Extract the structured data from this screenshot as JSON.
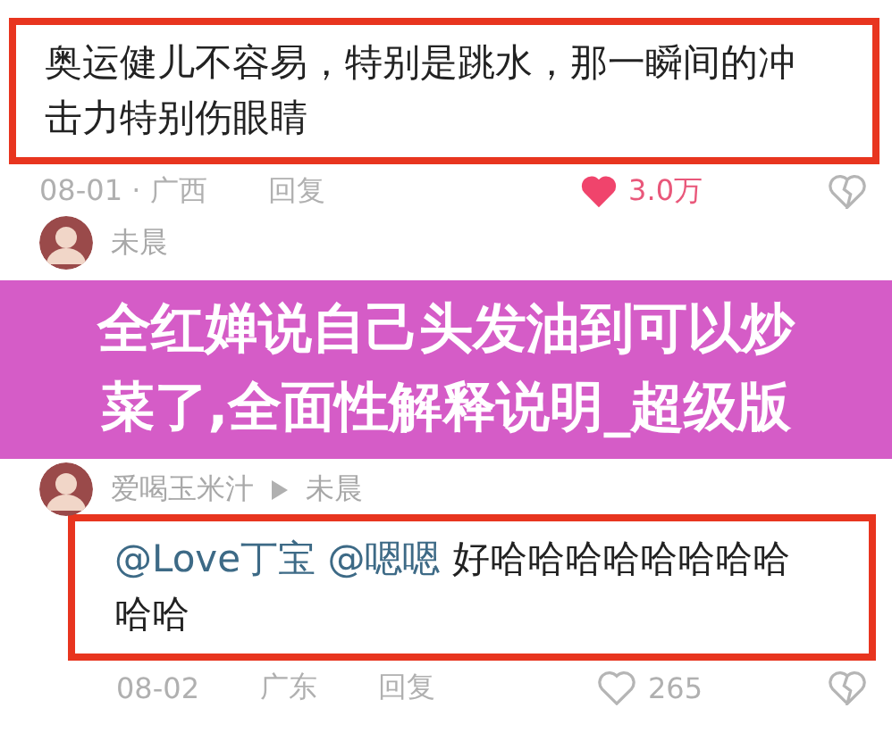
{
  "comments": [
    {
      "highlighted": true,
      "text": "奥运健儿不容易，特别是跳水，那一瞬间的冲击力特别伤眼睛",
      "time": "08-01 · 广西",
      "reply": "回复",
      "likes": "3.0万",
      "liked": true
    },
    {
      "author": "未晨"
    },
    {
      "author": "爱喝玉米汁",
      "reply_to": "未晨",
      "highlighted": true,
      "mentions": [
        "@Love丁宝",
        "@嗯嗯"
      ],
      "text": "好哈哈哈哈哈哈哈哈哈哈",
      "time": "08-02",
      "location": "广东",
      "reply": "回复",
      "likes": "265",
      "liked": false
    }
  ],
  "banner": {
    "title": "全红婵说自己头发油到可以炒菜了,全面性解释说明_超级版"
  }
}
